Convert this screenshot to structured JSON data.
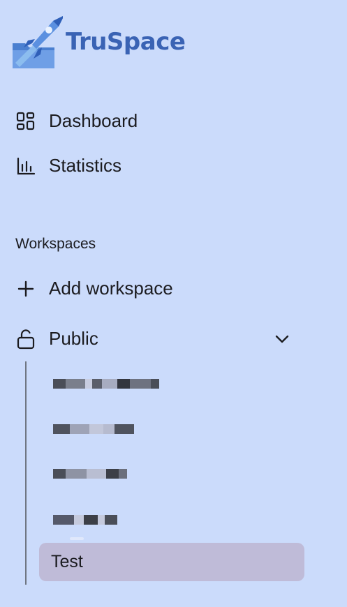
{
  "brand": {
    "name": "TruSpace"
  },
  "nav": [
    {
      "label": "Dashboard",
      "icon": "dashboard-grid-icon"
    },
    {
      "label": "Statistics",
      "icon": "bar-chart-icon"
    }
  ],
  "workspaces": {
    "section_label": "Workspaces",
    "add_label": "Add workspace",
    "group_label": "Public",
    "selected_item": "Test"
  },
  "colors": {
    "background": "#cbdbfb",
    "brand": "#3a63b4",
    "selected_bg": "#bfbbd8"
  }
}
